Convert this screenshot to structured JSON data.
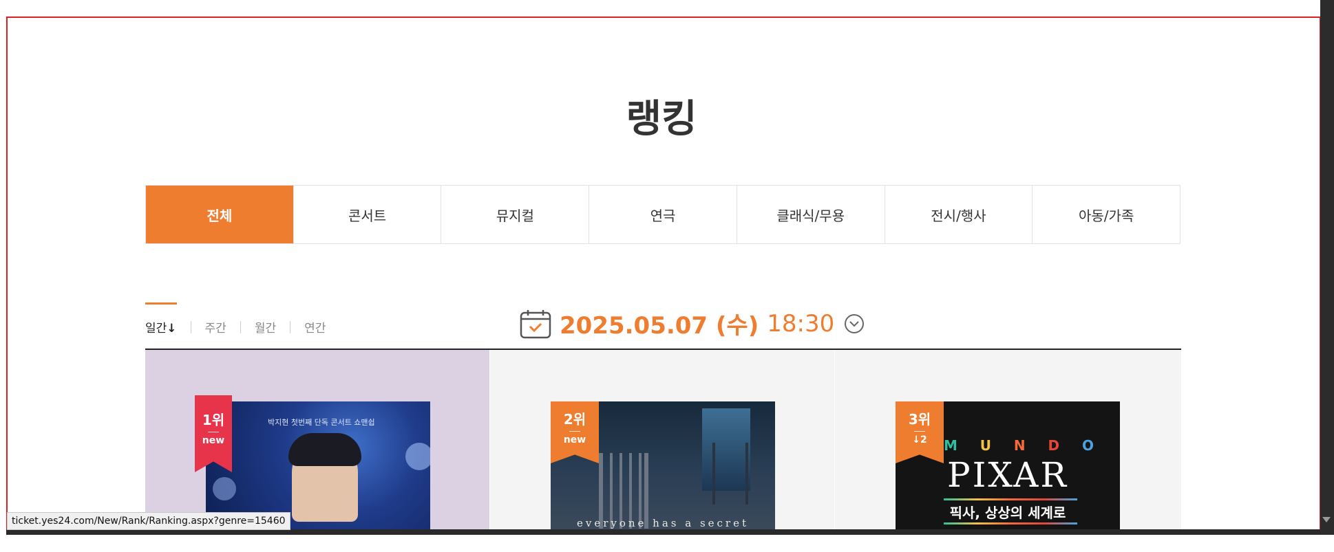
{
  "page_title": "랭킹",
  "genre_tabs": [
    "전체",
    "콘서트",
    "뮤지컬",
    "연극",
    "클래식/무용",
    "전시/행사",
    "아동/가족"
  ],
  "period_tabs": [
    "일간",
    "주간",
    "월간",
    "연간"
  ],
  "period_active_arrow": "↓",
  "date": "2025.05.07 (수)",
  "time": "18:30",
  "ranks": [
    {
      "rank": "1위",
      "change": "new",
      "poster_caption": "박지현 첫번째 단독 콘서트 쇼맨쉽"
    },
    {
      "rank": "2위",
      "change": "new",
      "poster_caption": "everyone has a secret"
    },
    {
      "rank": "3위",
      "change": "↓2",
      "poster_title": "PIXAR",
      "poster_mundo": [
        "M",
        "U",
        "N",
        "D",
        "O"
      ],
      "poster_subtitle": "픽사, 상상의 세계로"
    }
  ],
  "status_url": "ticket.yes24.com/New/Rank/Ranking.aspx?genre=15460",
  "colors": {
    "accent": "#ef7d2f",
    "rank1_badge": "#e7344b",
    "frame": "#e02020"
  },
  "icons": [
    "calendar-icon",
    "chevron-down-icon"
  ]
}
